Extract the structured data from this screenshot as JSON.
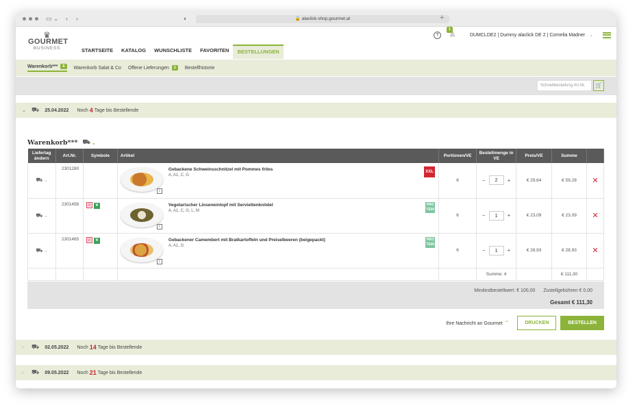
{
  "browser": {
    "url": "alaclick-shop.gourmet.at"
  },
  "logo": {
    "brand": "GOURMET",
    "sub": "BUSINESS"
  },
  "nav": {
    "items": [
      "STARTSEITE",
      "KATALOG",
      "WUNSCHLISTE",
      "FAVORITEN",
      "BESTELLUNGEN"
    ],
    "active": "BESTELLUNGEN"
  },
  "header": {
    "help": "?",
    "cart_badge": "1",
    "user": "DUMCLDE2 | Dummy alaclick DE 2 | Cornelia Madner"
  },
  "subnav": {
    "items": [
      {
        "label": "Warenkorb***",
        "badge": "6"
      },
      {
        "label": "Warenkorb Salat & Co",
        "badge": ""
      },
      {
        "label": "Offene Lieferungen",
        "badge": "1"
      },
      {
        "label": "Bestellhistorie",
        "badge": ""
      }
    ]
  },
  "quick_order": {
    "placeholder": "Schnellbestellung Art.Nr."
  },
  "days": [
    {
      "date": "25.04.2022",
      "prefix": "Noch",
      "count": "4",
      "suffix": "Tage bis Bestellende"
    },
    {
      "date": "02.05.2022",
      "prefix": "Noch",
      "count": "14",
      "suffix": "Tage bis Bestellende"
    },
    {
      "date": "09.05.2022",
      "prefix": "Noch",
      "count": "21",
      "suffix": "Tage bis Bestellende"
    }
  ],
  "cart": {
    "title": "Warenkorb***"
  },
  "table": {
    "headers": {
      "liefertag": "Liefertag ändern",
      "artnr": "Art.Nr.",
      "symbole": "Symbole",
      "artikel": "Artikel",
      "portionen": "Portionen/VE",
      "menge": "Bestellmenge in VE",
      "preis": "Preis/VE",
      "summe": "Summe"
    },
    "rows": [
      {
        "artnr": "2301280",
        "name": "Gebackene Schweinsschnitzel mit Pommes frites",
        "allergens": "A, A1, C, G",
        "tag": "XXL",
        "portions": "6",
        "qty": "2",
        "price": "€ 29,64",
        "sum": "€ 59,28"
      },
      {
        "artnr": "2301456",
        "name": "Vegetarischer Linseneintopf mit Serviettenknödel",
        "allergens": "A, A1, C, G, L, M",
        "tag": "PRO TEIN",
        "portions": "6",
        "qty": "1",
        "price": "€ 23,09",
        "sum": "€ 23,09"
      },
      {
        "artnr": "2301465",
        "name": "Gebackener Camembert mit Bratkartoffeln und Preiselbeeren (beigepackt)",
        "allergens": "A, A1, G",
        "tag": "PRO TEIN",
        "portions": "6",
        "qty": "1",
        "price": "€ 28,93",
        "sum": "€ 28,93"
      }
    ],
    "summe_label": "Summe: 4",
    "summe_total": "€ 111,30"
  },
  "summary": {
    "min_order": "Mindestbestellwert: € 100,00",
    "delivery_fee": "Zustellgebühren € 0,00",
    "total": "Gesamt € 111,30"
  },
  "actions": {
    "message": "Ihre Nachricht an Gourmet",
    "print": "DRUCKEN",
    "order": "BESTELLEN"
  },
  "colors": {
    "accent": "#8cb43a",
    "light": "#e8ecd9",
    "danger": "#d22630"
  }
}
